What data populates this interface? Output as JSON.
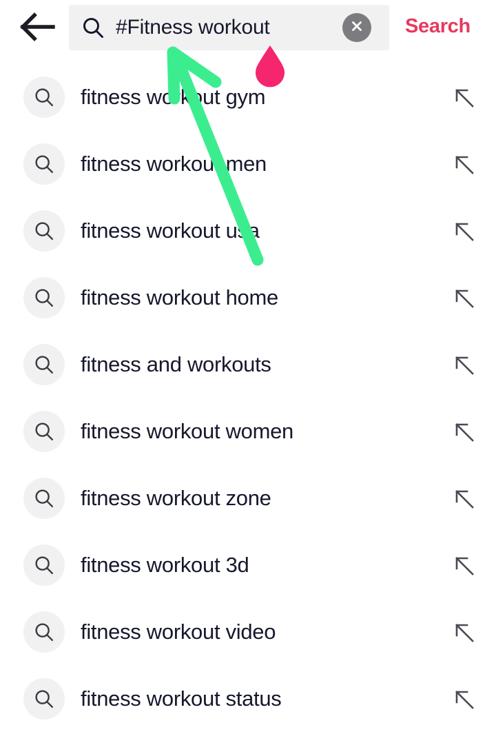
{
  "header": {
    "back_icon": "back-arrow-icon",
    "search_icon": "search-icon",
    "query_value": "#Fitness workout",
    "query_placeholder": "Search",
    "clear_icon": "close-circle-icon",
    "search_button_label": "Search",
    "accent_color": "#e8395e",
    "field_background": "#f1f1f2"
  },
  "suggestions": {
    "row_icon": "search-icon",
    "row_action_icon": "arrow-up-left-icon",
    "items": [
      {
        "label": "fitness workout gym"
      },
      {
        "label": "fitness workout men"
      },
      {
        "label": "fitness workout usa"
      },
      {
        "label": "fitness workout home"
      },
      {
        "label": "fitness and workouts"
      },
      {
        "label": "fitness workout women"
      },
      {
        "label": "fitness workout zone"
      },
      {
        "label": "fitness workout 3d"
      },
      {
        "label": "fitness workout video"
      },
      {
        "label": "fitness workout status"
      }
    ]
  },
  "annotations": {
    "arrow": {
      "name": "green-pointer-arrow",
      "color": "#3ced8f"
    },
    "marker": {
      "name": "pink-teardrop-marker",
      "color": "#f5266e"
    }
  },
  "colors": {
    "text": "#16182c",
    "icon_bubble": "#f1f1f2",
    "clear_circle": "#7c7c80",
    "page_background": "#ffffff"
  }
}
